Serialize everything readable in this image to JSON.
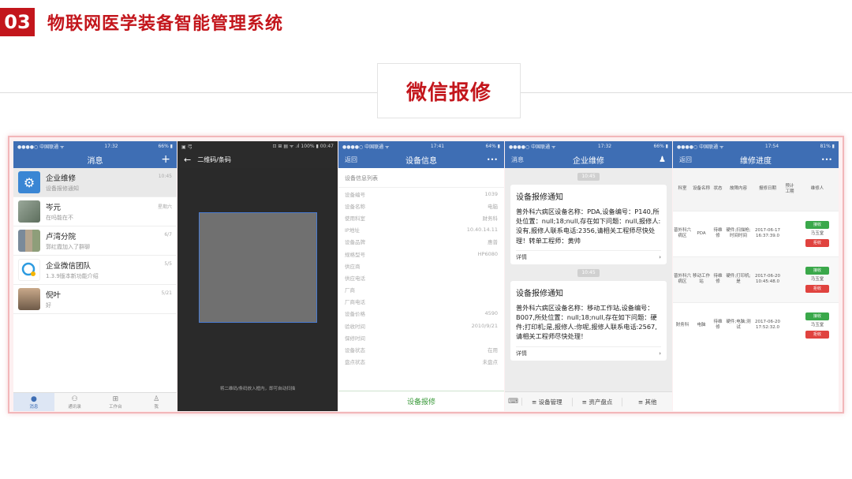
{
  "header": {
    "number": "03",
    "title": "物联网医学装备智能管理系统",
    "subtitle": "微信报修"
  },
  "colors": {
    "accent_red": "#c3161c",
    "wechat_blue": "#3e6eb4",
    "button_green": "#3aa84a",
    "button_red": "#e0433f"
  },
  "phone1": {
    "status": {
      "carrier": "●●●●○ 中国联通 ᯤ",
      "time": "17:32",
      "battery": "66% ▮"
    },
    "title": "消息",
    "add_icon": "plus-icon",
    "chats": [
      {
        "name": "企业维修",
        "preview": "设备报修通知",
        "time": "10:45",
        "icon": "gear-icon"
      },
      {
        "name": "岑元",
        "preview": "在吗能在不",
        "time": "星期六",
        "icon": "avatar"
      },
      {
        "name": "卢湾分院",
        "preview": "郭红霞加入了群聊",
        "time": "6/7",
        "icon": "group-avatar"
      },
      {
        "name": "企业微信团队",
        "preview": "1.3.9版本新功能介绍",
        "time": "5/5",
        "icon": "wework-icon"
      },
      {
        "name": "倪叶",
        "preview": "好",
        "time": "5/21",
        "icon": "avatar"
      }
    ],
    "tabs": [
      {
        "label": "消息",
        "icon": "chat-icon"
      },
      {
        "label": "通讯录",
        "icon": "contacts-icon"
      },
      {
        "label": "工作台",
        "icon": "grid-icon"
      },
      {
        "label": "我",
        "icon": "person-icon"
      }
    ]
  },
  "phone2": {
    "status": {
      "left": "▣ 弓",
      "right": "⊡ ⊞ ▤ ᯤ .ıl 100% ▮ 00:47"
    },
    "back_icon": "back-arrow-icon",
    "title": "二维码/条码",
    "tip": "将二维码/条码放入框内，即可自动扫描"
  },
  "phone3": {
    "status": {
      "carrier": "●●●●○ 中国联通 ᯤ",
      "time": "17:41",
      "battery": "64% ▮"
    },
    "back": "返回",
    "title": "设备信息",
    "more": "•••",
    "list_title": "设备信息列表",
    "rows": [
      {
        "label": "设备编号",
        "value": "1039"
      },
      {
        "label": "设备名称",
        "value": "电脑"
      },
      {
        "label": "使用科室",
        "value": "财务科"
      },
      {
        "label": "IP地址",
        "value": "10.40.14.11"
      },
      {
        "label": "设备品牌",
        "value": "惠普"
      },
      {
        "label": "规格型号",
        "value": "HP6080"
      },
      {
        "label": "供应商",
        "value": ""
      },
      {
        "label": "供应电话",
        "value": ""
      },
      {
        "label": "厂商",
        "value": ""
      },
      {
        "label": "厂商电话",
        "value": ""
      },
      {
        "label": "设备价格",
        "value": "4590"
      },
      {
        "label": "验收时间",
        "value": "2010/9/21"
      },
      {
        "label": "保修时间",
        "value": ""
      },
      {
        "label": "设备状态",
        "value": "在用"
      },
      {
        "label": "盘点状态",
        "value": "未盘点"
      }
    ],
    "report_button": "设备报修"
  },
  "phone4": {
    "status": {
      "carrier": "●●●●○ 中国联通 ᯤ",
      "time": "17:32",
      "battery": "66% ▮"
    },
    "back": "消息",
    "title": "企业维修",
    "person_icon": "person-icon",
    "date1": "10:45",
    "date2": "10:45",
    "cards": [
      {
        "title": "设备报修通知",
        "body": "普外科六病区设备名称：PDA,设备编号：P140,所处位置：null;18;null,存在如下问题：null,报修人:没有,报修人联系电话:2356,请相关工程师尽快处理！转单工程师：黄帅",
        "more": "详情"
      },
      {
        "title": "设备报修通知",
        "body": "普外科六病区设备名称：移动工作站,设备编号：B007,所处位置：null;18;null,存在如下问题：硬件;打印机;是,报修人:你呢,报修人联系电话:2567,请相关工程师尽快处理！",
        "more": "详情"
      }
    ],
    "menu": [
      "设备管理",
      "资产盘点",
      "其他"
    ]
  },
  "phone5": {
    "status": {
      "carrier": "●●●●○ 中国联通 ᯤ",
      "time": "17:54",
      "battery": "81% ▮"
    },
    "back": "返回",
    "title": "维修进度",
    "more": "•••",
    "columns": [
      "科室",
      "设备名称",
      "状态",
      "故障内容",
      "报修日期",
      "预计工期",
      "维修人"
    ],
    "rows": [
      {
        "dept": "普外科六病区",
        "device": "PDA",
        "status": "待维修",
        "fault": "硬件;扫描枪;时间时间",
        "date": "2017-06-17 16:37:39.0",
        "days": "",
        "worker": "马玉堂",
        "btn1": "接收",
        "btn2": "拒收"
      },
      {
        "dept": "普外科六病区",
        "device": "移动工作站",
        "status": "待维修",
        "fault": "硬件;打印机;是",
        "date": "2017-06-20 10:45:48.0",
        "days": "",
        "worker": "马玉堂",
        "btn1": "接收",
        "btn2": "拒收"
      },
      {
        "dept": "财务科",
        "device": "电脑",
        "status": "待维修",
        "fault": "硬件;电脑;测试",
        "date": "2017-06-20 17:52:32.0",
        "days": "",
        "worker": "马玉堂",
        "btn1": "接收",
        "btn2": "拒收"
      }
    ]
  }
}
